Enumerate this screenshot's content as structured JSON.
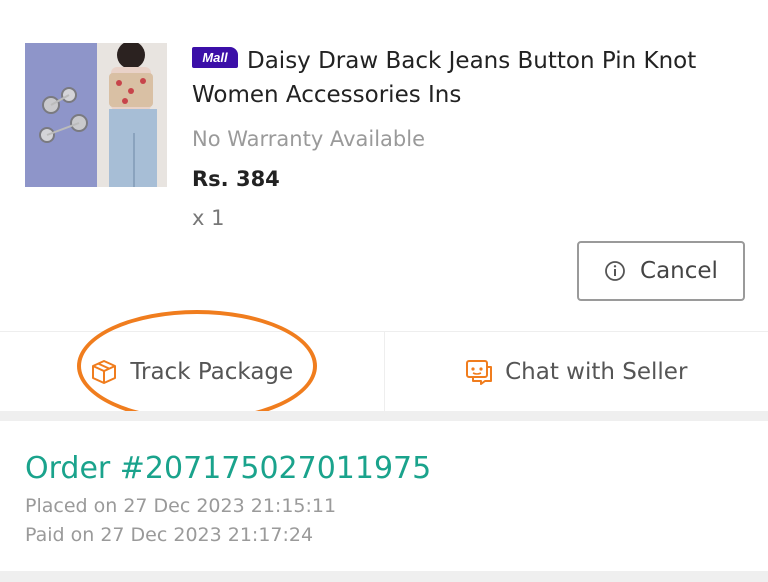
{
  "product": {
    "badge": "Mall",
    "title": "Daisy Draw Back Jeans Button Pin Knot Women Accessories Ins",
    "warranty": "No Warranty Available",
    "price": "Rs. 384",
    "quantity": "x 1",
    "image_icon": "product-photo"
  },
  "buttons": {
    "cancel_label": "Cancel",
    "cancel_icon": "info-icon"
  },
  "actions": {
    "track_label": "Track Package",
    "track_icon": "package-icon",
    "chat_label": "Chat with Seller",
    "chat_icon": "chat-icon"
  },
  "order": {
    "number": "Order #207175027011975",
    "placed": "Placed on 27 Dec 2023  21:15:11",
    "paid": "Paid on 27 Dec 2023  21:17:24"
  },
  "colors": {
    "accent_teal": "#1aa38c",
    "highlight_orange": "#f07d1e",
    "mall_purple": "#3b0fa8",
    "icon_orange": "#f07d1e"
  }
}
